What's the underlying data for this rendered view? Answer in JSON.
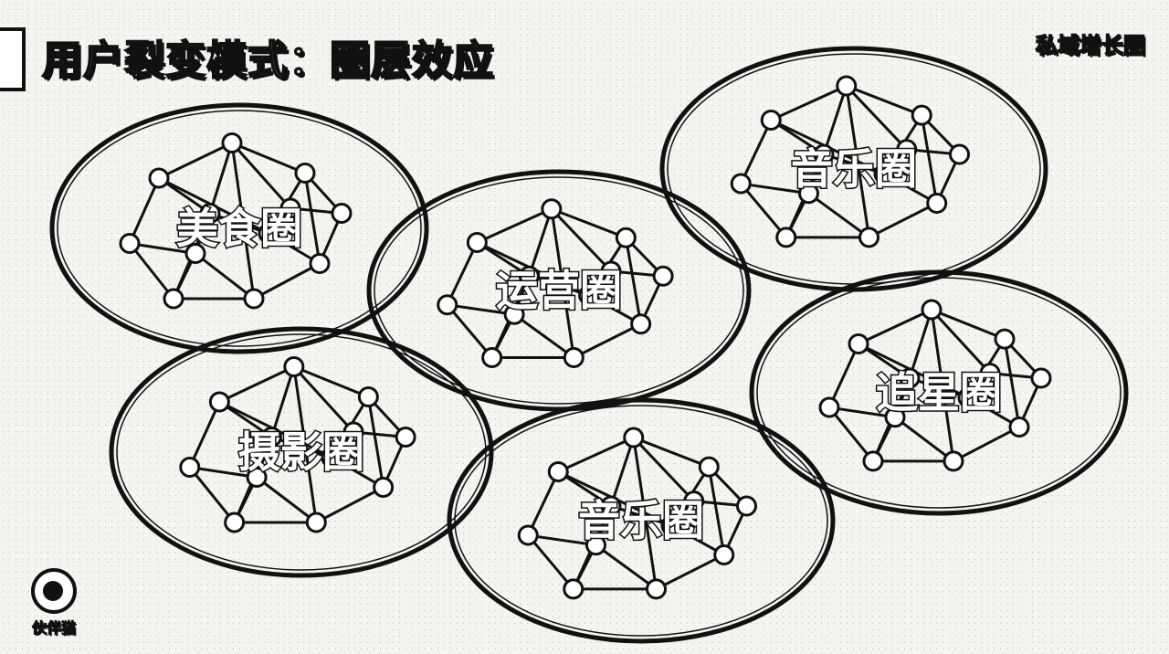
{
  "header": {
    "title": "用户裂变模式：圈层效应",
    "brand": "私域增长圈"
  },
  "footer": {
    "logo_text": "伙伴猫",
    "logo_icon": "cat-head-icon"
  },
  "circles": [
    {
      "id": "food",
      "label": "美食圈"
    },
    {
      "id": "operations",
      "label": "运营圈"
    },
    {
      "id": "music-top",
      "label": "音乐圈"
    },
    {
      "id": "photography",
      "label": "摄影圈"
    },
    {
      "id": "music-bottom",
      "label": "音乐圈"
    },
    {
      "id": "celebrity",
      "label": "追星圈"
    }
  ]
}
